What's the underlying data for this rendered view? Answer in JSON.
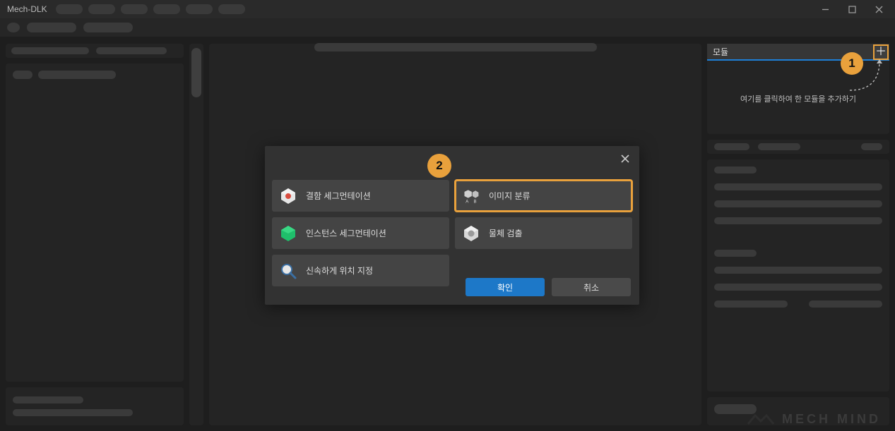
{
  "window": {
    "title": "Mech-DLK"
  },
  "callouts": {
    "one": "1",
    "two": "2"
  },
  "right_panel": {
    "module_label": "모듈",
    "hint": "여기를 클릭하여 한 모듈을 추가하기",
    "add_tooltip": "add-module"
  },
  "modal": {
    "options": {
      "defect_seg": "결함 세그먼테이션",
      "instance_seg": "인스턴스 세그먼테이션",
      "quick_locate": "신속하게 위치 지정",
      "image_class": "이미지 분류",
      "object_det": "물체 검출"
    },
    "buttons": {
      "ok": "확인",
      "cancel": "취소"
    }
  },
  "watermark": "MECH MIND"
}
